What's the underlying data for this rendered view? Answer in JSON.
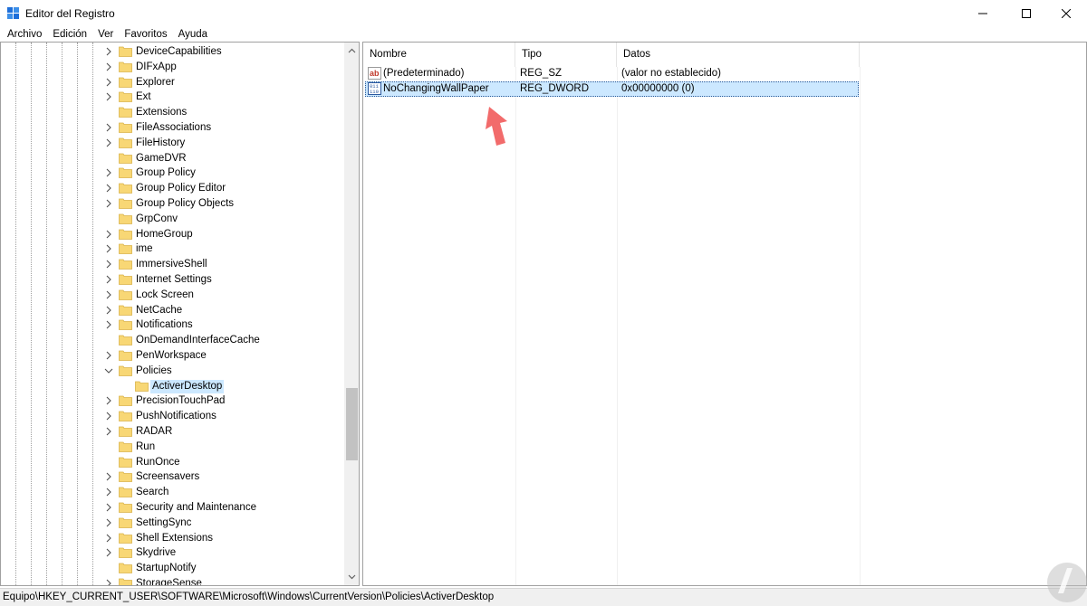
{
  "window": {
    "title": "Editor del Registro",
    "icon": "regedit-icon"
  },
  "menu": {
    "items": [
      "Archivo",
      "Edición",
      "Ver",
      "Favoritos",
      "Ayuda"
    ]
  },
  "tree": {
    "items": [
      {
        "label": "DeviceCapabilities",
        "expander": "collapsed"
      },
      {
        "label": "DIFxApp",
        "expander": "collapsed"
      },
      {
        "label": "Explorer",
        "expander": "collapsed"
      },
      {
        "label": "Ext",
        "expander": "collapsed"
      },
      {
        "label": "Extensions",
        "expander": "none"
      },
      {
        "label": "FileAssociations",
        "expander": "collapsed"
      },
      {
        "label": "FileHistory",
        "expander": "collapsed"
      },
      {
        "label": "GameDVR",
        "expander": "none"
      },
      {
        "label": "Group Policy",
        "expander": "collapsed"
      },
      {
        "label": "Group Policy Editor",
        "expander": "collapsed"
      },
      {
        "label": "Group Policy Objects",
        "expander": "collapsed"
      },
      {
        "label": "GrpConv",
        "expander": "none"
      },
      {
        "label": "HomeGroup",
        "expander": "collapsed"
      },
      {
        "label": "ime",
        "expander": "collapsed"
      },
      {
        "label": "ImmersiveShell",
        "expander": "collapsed"
      },
      {
        "label": "Internet Settings",
        "expander": "collapsed"
      },
      {
        "label": "Lock Screen",
        "expander": "collapsed"
      },
      {
        "label": "NetCache",
        "expander": "collapsed"
      },
      {
        "label": "Notifications",
        "expander": "collapsed"
      },
      {
        "label": "OnDemandInterfaceCache",
        "expander": "none"
      },
      {
        "label": "PenWorkspace",
        "expander": "collapsed"
      },
      {
        "label": "Policies",
        "expander": "expanded"
      },
      {
        "label": "ActiverDesktop",
        "expander": "none",
        "child": true,
        "selected": true
      },
      {
        "label": "PrecisionTouchPad",
        "expander": "collapsed"
      },
      {
        "label": "PushNotifications",
        "expander": "collapsed"
      },
      {
        "label": "RADAR",
        "expander": "collapsed"
      },
      {
        "label": "Run",
        "expander": "none"
      },
      {
        "label": "RunOnce",
        "expander": "none"
      },
      {
        "label": "Screensavers",
        "expander": "collapsed"
      },
      {
        "label": "Search",
        "expander": "collapsed"
      },
      {
        "label": "Security and Maintenance",
        "expander": "collapsed"
      },
      {
        "label": "SettingSync",
        "expander": "collapsed"
      },
      {
        "label": "Shell Extensions",
        "expander": "collapsed"
      },
      {
        "label": "Skydrive",
        "expander": "collapsed"
      },
      {
        "label": "StartupNotify",
        "expander": "none"
      },
      {
        "label": "StorageSense",
        "expander": "collapsed"
      }
    ]
  },
  "values": {
    "columns": [
      "Nombre",
      "Tipo",
      "Datos"
    ],
    "rows": [
      {
        "name": "(Predeterminado)",
        "type": "REG_SZ",
        "data": "(valor no establecido)",
        "icon": "string-value-icon",
        "selected": false
      },
      {
        "name": "NoChangingWallPaper",
        "type": "REG_DWORD",
        "data": "0x00000000 (0)",
        "icon": "binary-value-icon",
        "selected": true
      }
    ]
  },
  "status": {
    "path": "Equipo\\HKEY_CURRENT_USER\\SOFTWARE\\Microsoft\\Windows\\CurrentVersion\\Policies\\ActiverDesktop"
  },
  "colors": {
    "selection": "#cce8ff",
    "folder": "#f8d775",
    "annotation_arrow": "#f26b6b"
  }
}
